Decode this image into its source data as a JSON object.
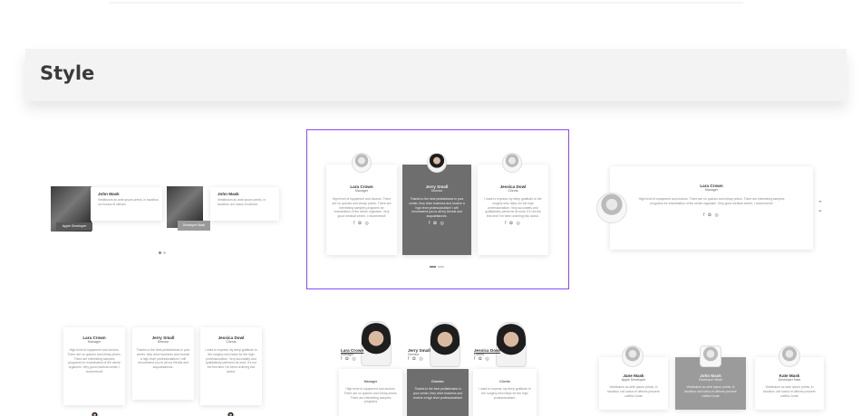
{
  "section": {
    "title": "Style"
  },
  "variant1": {
    "cards": [
      {
        "name": "John Mask",
        "text": "Vestibulum ac ante ipsum primis, in faucibus orci luctus et ultrices",
        "caption": "Apple Developer"
      },
      {
        "name": "John Mask",
        "text": "Vestibulum ac ante ipsum primis, in faucibus orci luctus et ultrices",
        "caption": "Developer Mask"
      }
    ]
  },
  "variant2": {
    "cards": [
      {
        "name": "Lara Crown",
        "role": "Manager",
        "text": "High level of equipment and doctors. There are no queues and cheap prices. There are interesting samples programs for examination of the whole organism. Very good medical center, I recommend!",
        "icons": "f ✿ ◎"
      },
      {
        "name": "Jerry Small",
        "role": "Director",
        "text": "Thanks to the best pediatricians in your center, they drive business and receive a high level professionalism! I will recommend you to all my friends and acquaintances.",
        "icons": "f ✿ ◎"
      },
      {
        "name": "Jessica Dowl",
        "role": "Clients",
        "text": "I want to express my deep gratitude to the surgery who helps for the high professionalism. Very accurately and qualitatively performs its work. It's not the first time I've been ordering this doctor.",
        "icons": "f ✿ ◎"
      }
    ]
  },
  "variant3": {
    "name": "Lara Crown",
    "role": "Manager",
    "text": "High level of equipment and doctors. There are no queues and cheap prices. There are interesting samples programs for examination of the whole organism. Very good medical center, I recommend!",
    "icons": "f ✿ ◎",
    "arrow_up": "⌃",
    "arrow_down": "⌄"
  },
  "variant4": {
    "cards": [
      {
        "name": "Lara Crown",
        "role": "Manager",
        "text": "High level of equipment and doctors. There are no queues and cheap prices. There are interesting samples programs for examination of the whole organism. Very good medical center, I recommend!"
      },
      {
        "name": "Jerry Small",
        "role": "Director",
        "text": "Thanks to the best pediatricians in your center, they drive business and receive a high level professionalism! I will recommend you to all my friends and acquaintances."
      },
      {
        "name": "Jessica Dowl",
        "role": "Clients",
        "text": "I want to express my deep gratitude to the surgery who helps for the high professionalism. Very accurately and qualitatively performs its work. It's not the first time I've been ordering this doctor."
      }
    ]
  },
  "variant5": {
    "people": [
      {
        "name": "Lara Crown",
        "role": "Manager",
        "icons": "f ✿ ◎",
        "text": "High level of equipment and doctors. There are no queues and cheap prices. There are interesting samples programs"
      },
      {
        "name": "Jerry Small",
        "role": "Director",
        "icons": "f ✿ ◎",
        "text": "Thanks to the best pediatricians in your center, they drive business and receive a high level professionalism!"
      },
      {
        "name": "Jessica Dowl",
        "role": "Clients",
        "icons": "f ✿ ◎",
        "text": "I want to express my deep gratitude to the surgery who helps for the high professionalism."
      }
    ]
  },
  "variant6": {
    "cards": [
      {
        "name": "Jane Mask",
        "role": "Apple Developer",
        "text": "Vestibulum ac ante ipsum primis, in faucibus orci luctus et ultrices posuere cubilia Curae"
      },
      {
        "name": "John Mask",
        "role": "Developer Mask",
        "text": "Vestibulum ac ante ipsum primis, in faucibus orci luctus et ultrices posuere cubilia Curae"
      },
      {
        "name": "Kate Mask",
        "role": "Developer Kate",
        "text": "Vestibulum ac ante ipsum primis, in faucibus orci luctus et ultrices posuere cubilia Curae"
      }
    ]
  }
}
